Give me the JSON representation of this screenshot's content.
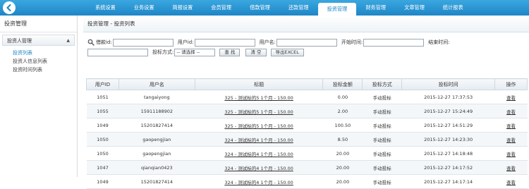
{
  "nav": {
    "items": [
      "系统设置",
      "业务设置",
      "简报设置",
      "会员管理",
      "借款管理",
      "还款管理",
      "投资管理",
      "财务管理",
      "文章管理",
      "统计报表"
    ],
    "active_index": 6
  },
  "sidebar": {
    "title": "投资管理",
    "group_label": "投资人管理",
    "items": [
      "投资列表",
      "投资人信息列表",
      "投资时间列表"
    ]
  },
  "breadcrumb": "投资管理 - 投资列表",
  "search": {
    "borrow_id_label": "借款id:",
    "user_id_label": "用户id:",
    "username_label": "用户名:",
    "start_time_label": "开始时间:",
    "end_time_label": "结束时间:",
    "invest_type_label": "投标方式:",
    "invest_type_value": "-- 请选择 --",
    "query_button": "查 找",
    "clear_button": "清 空",
    "export_button": "导出EXCEL"
  },
  "table": {
    "headers": [
      "用户ID",
      "用户名",
      "标题",
      "投标金额",
      "投标方式",
      "投标时间",
      "操作"
    ],
    "rows": [
      [
        "1051",
        "tangaiyong",
        "325 - 测试标的5   1个月 - 150.00",
        "0.00",
        "手动投标",
        "2015-12-27 17:37:53",
        "查看"
      ],
      [
        "1055",
        "15911188902",
        "325 - 测试标的5   1个月 - 150.00",
        "2.00",
        "手动投标",
        "2015-12-27 15:24:49",
        "查看"
      ],
      [
        "1049",
        "15201827414",
        "325 - 测试标的5   1个月 - 150.00",
        "100.50",
        "手动投标",
        "2015-12-27 14:51:29",
        "查看"
      ],
      [
        "1050",
        "gaopengjian",
        "324 - 测试标的4   1个月 - 150.00",
        "8.50",
        "手动投标",
        "2015-12-27 14:23:30",
        "查看"
      ],
      [
        "1050",
        "gaopengjian",
        "324 - 测试标的4   1个月 - 150.00",
        "20.00",
        "手动投标",
        "2015-12-27 14:18:48",
        "查看"
      ],
      [
        "1047",
        "qianqian0423",
        "324 - 测试标的4   1个月 - 150.00",
        "20.00",
        "手动投标",
        "2015-12-27 14:17:52",
        "查看"
      ],
      [
        "1049",
        "15201827414",
        "324 - 测试标的4   1个月 - 150.00",
        "20.00",
        "手动投标",
        "2015-12-27 14:17:14",
        "查看"
      ]
    ]
  },
  "colors": {
    "accent": "#1f86c6",
    "topbar": "#2b97d4"
  }
}
